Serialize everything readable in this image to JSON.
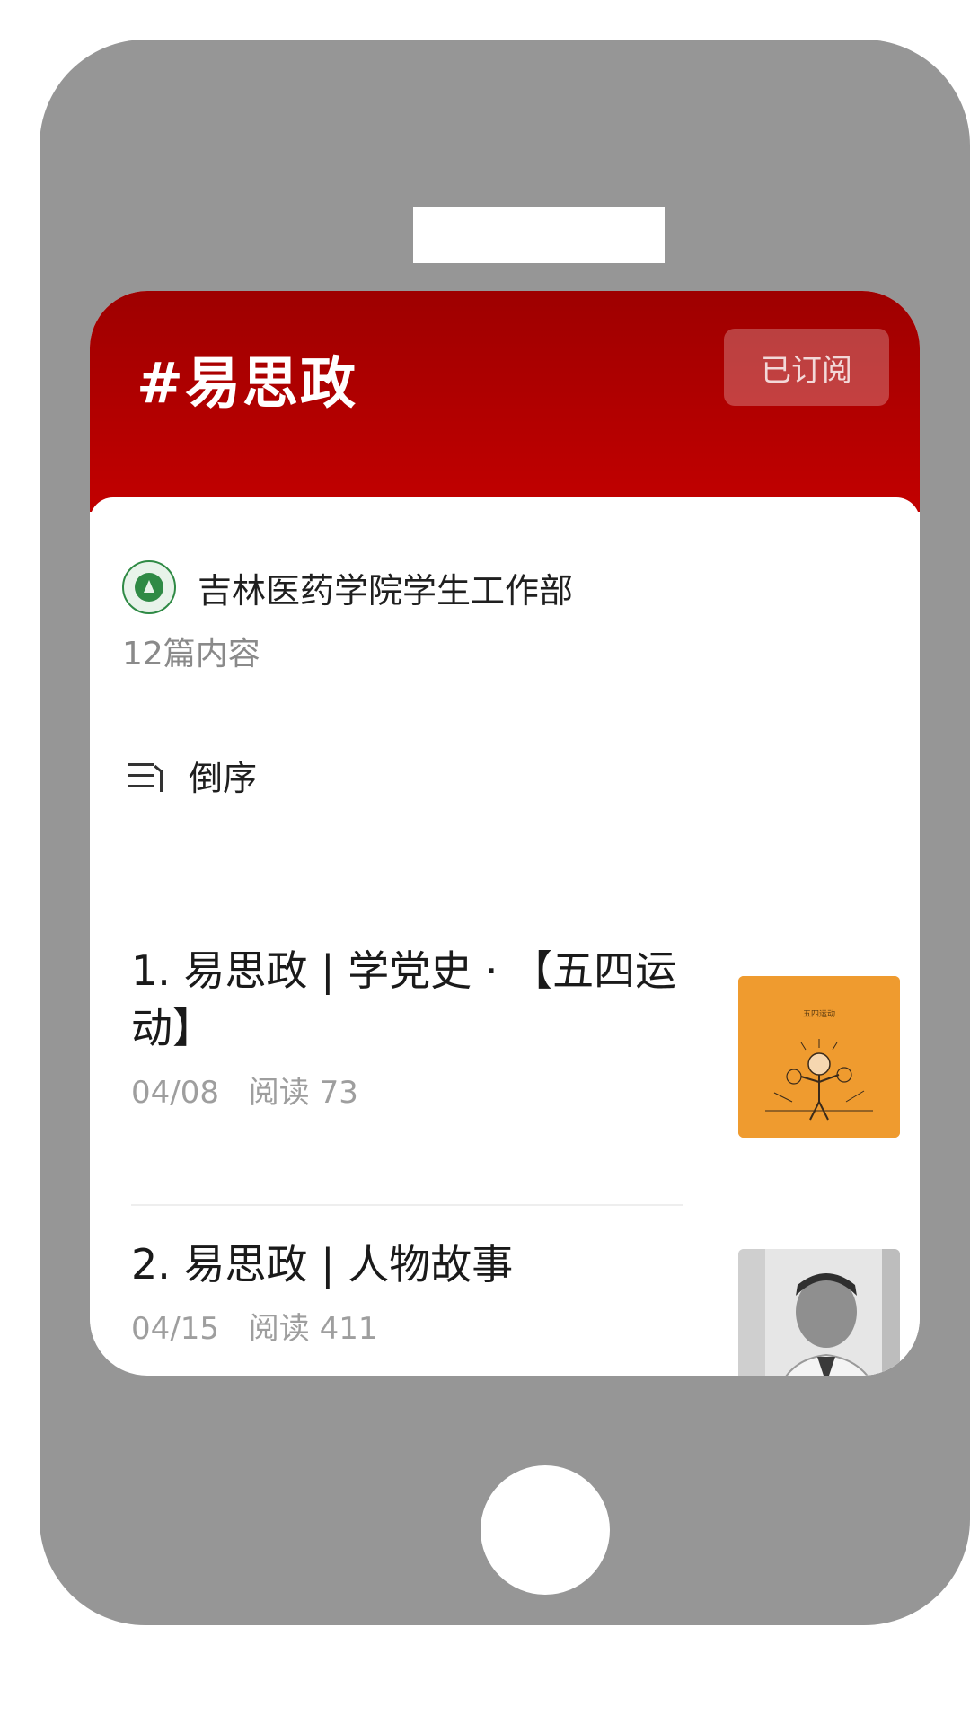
{
  "topic": {
    "title": "#易思政",
    "subscribe_label": "已订阅"
  },
  "author": {
    "name": "吉林医药学院学生工作部",
    "post_count": "12篇内容"
  },
  "sort": {
    "label": "倒序",
    "icon": "sort-descending-icon"
  },
  "articles": [
    {
      "title": "1. 易思政 | 学党史 · 【五四运动】",
      "date": "04/08",
      "reads": "阅读 73",
      "thumbnail_color": "#ef9b2f",
      "thumbnail_caption": "五四运动"
    },
    {
      "title": "2. 易思政 | 人物故事",
      "date": "04/15",
      "reads": "阅读 411",
      "thumbnail_color": "#dcdcdc"
    }
  ],
  "colors": {
    "header": "#b30000",
    "phone_frame": "#969696"
  }
}
